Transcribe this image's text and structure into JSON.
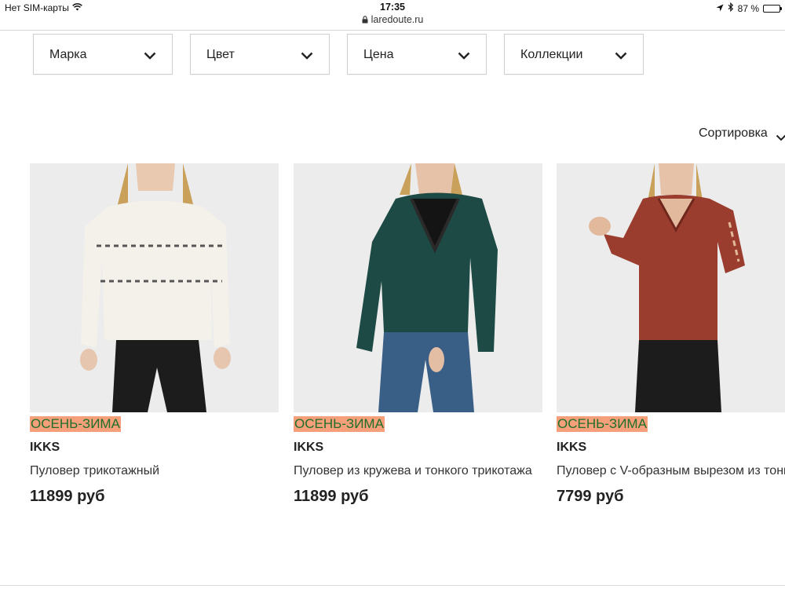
{
  "status": {
    "carrier": "Нет SIM-карты",
    "time": "17:35",
    "battery": "87 %",
    "battery_level": 0.87,
    "url": "laredoute.ru"
  },
  "filters": [
    {
      "label": "Марка"
    },
    {
      "label": "Цвет"
    },
    {
      "label": "Цена"
    },
    {
      "label": "Коллекции"
    }
  ],
  "sort": {
    "label": "Сортировка"
  },
  "products": [
    {
      "badge": "ОСЕНЬ-ЗИМА",
      "brand": "IKKS",
      "name": "Пуловер трикотажный",
      "price": "11899 руб",
      "image": "white sweater"
    },
    {
      "badge": "ОСЕНЬ-ЗИМА",
      "brand": "IKKS",
      "name": "Пуловер из кружева и тонкого трикотажа",
      "price": "11899 руб",
      "image": "green wrap sweater"
    },
    {
      "badge": "ОСЕНЬ-ЗИМА",
      "brand": "IKKS",
      "name": "Пуловер с V-образным вырезом из тонкого",
      "price": "7799 руб",
      "image": "rust v-neck sweater"
    }
  ],
  "colors": {
    "badge_bg": "#f5a07a",
    "badge_text": "#1f6f2a"
  }
}
